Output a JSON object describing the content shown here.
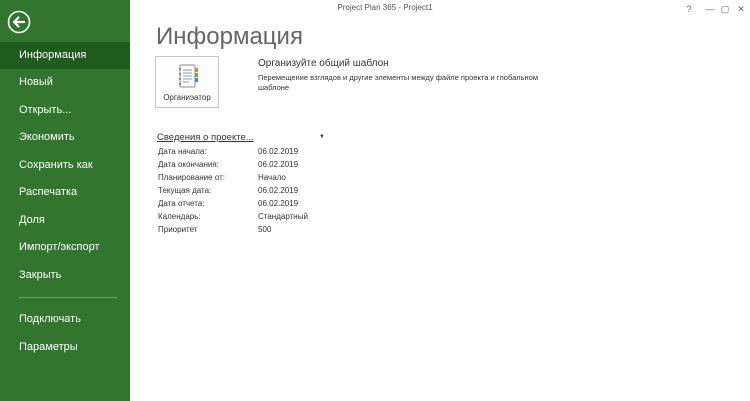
{
  "window": {
    "title": "Project Plan 365 - Project1",
    "help": "?",
    "minimize": "—",
    "restore": "▢",
    "close": "✕"
  },
  "sidebar": {
    "back_icon": "arrow-left-circle-icon",
    "items": [
      {
        "label": "Информация",
        "active": true
      },
      {
        "label": "Новый"
      },
      {
        "label": "Открыть..."
      },
      {
        "label": "Экономить"
      },
      {
        "label": "Сохранить как"
      },
      {
        "label": "Распечатка"
      },
      {
        "label": "Доля"
      },
      {
        "label": "Импорт/экспорт"
      },
      {
        "label": "Закрыть"
      },
      {
        "label": "Подключать"
      },
      {
        "label": "Параметры"
      }
    ]
  },
  "main": {
    "title": "Информация",
    "organizer": {
      "button_label": "Органиэатор",
      "icon": "notebook-icon",
      "heading": "Организуйте общий шаблон",
      "description": "Перемещение взглядов и другие элементы между файле проекта и глобальном шаблоне"
    },
    "properties": {
      "header": "Сведения о проекте...",
      "rows": [
        {
          "label": "Дата начала:",
          "value": "06.02.2019"
        },
        {
          "label": "Дата окончания:",
          "value": "06.02.2019"
        },
        {
          "label": "Планирование от:",
          "value": "Начало"
        },
        {
          "label": "Текущая дата:",
          "value": "06.02.2019"
        },
        {
          "label": "Дата отчета:",
          "value": "06.02.2019"
        },
        {
          "label": "Календарь:",
          "value": "Стандартный"
        },
        {
          "label": "Приоритет",
          "value": "500"
        }
      ]
    }
  },
  "colors": {
    "sidebar": "#31752f",
    "sidebar_active": "#1e5b1d"
  }
}
